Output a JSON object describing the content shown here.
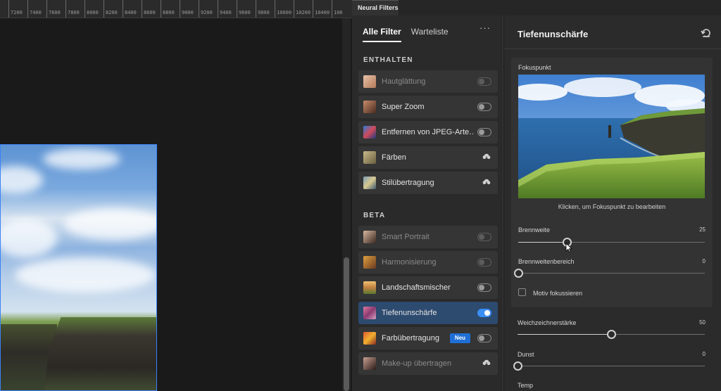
{
  "ruler": {
    "ticks": [
      "7200",
      "7400",
      "7600",
      "7800",
      "8000",
      "8200",
      "8400",
      "8600",
      "8800",
      "9000",
      "9200",
      "9400",
      "9600",
      "9800",
      "10000",
      "10200",
      "10400",
      "106"
    ]
  },
  "panel": {
    "tab_title": "Neural Filters"
  },
  "list": {
    "tabs": [
      "Alle Filter",
      "Warteliste"
    ],
    "more_label": "···",
    "section_included": "ENTHALTEN",
    "section_beta": "BETA",
    "badge_new": "Neu",
    "filters_included": [
      {
        "name": "Hautglättung",
        "state": "off-dim"
      },
      {
        "name": "Super Zoom",
        "state": "off"
      },
      {
        "name": "Entfernen von JPEG-Arte…",
        "state": "off"
      },
      {
        "name": "Färben",
        "state": "download"
      },
      {
        "name": "Stilübertragung",
        "state": "download"
      }
    ],
    "filters_beta": [
      {
        "name": "Smart Portrait",
        "state": "off-dim"
      },
      {
        "name": "Harmonisierung",
        "state": "off-dim"
      },
      {
        "name": "Landschaftsmischer",
        "state": "off"
      },
      {
        "name": "Tiefenunschärfe",
        "state": "on"
      },
      {
        "name": "Farbübertragung",
        "state": "off"
      },
      {
        "name": "Make-up übertragen",
        "state": "download-dim"
      }
    ]
  },
  "settings": {
    "title": "Tiefenunschärfe",
    "focus_label": "Fokuspunkt",
    "focus_caption": "Klicken, um Fokuspunkt zu bearbeiten",
    "sliders": [
      {
        "label": "Brennweite",
        "value": "25",
        "fraction": 0.26
      },
      {
        "label": "Brennweitenbereich",
        "value": "0",
        "fraction": 0.0
      },
      {
        "label": "Weichzeichnerstärke",
        "value": "50",
        "fraction": 0.5
      },
      {
        "label": "Dunst",
        "value": "0",
        "fraction": 0.0
      }
    ],
    "checkbox_label": "Motiv fokussieren",
    "temp_label": "Temp"
  },
  "colors": {
    "accent": "#3a8ef6",
    "selected_row": "#2d4a6f",
    "badge": "#1f6fd6"
  }
}
